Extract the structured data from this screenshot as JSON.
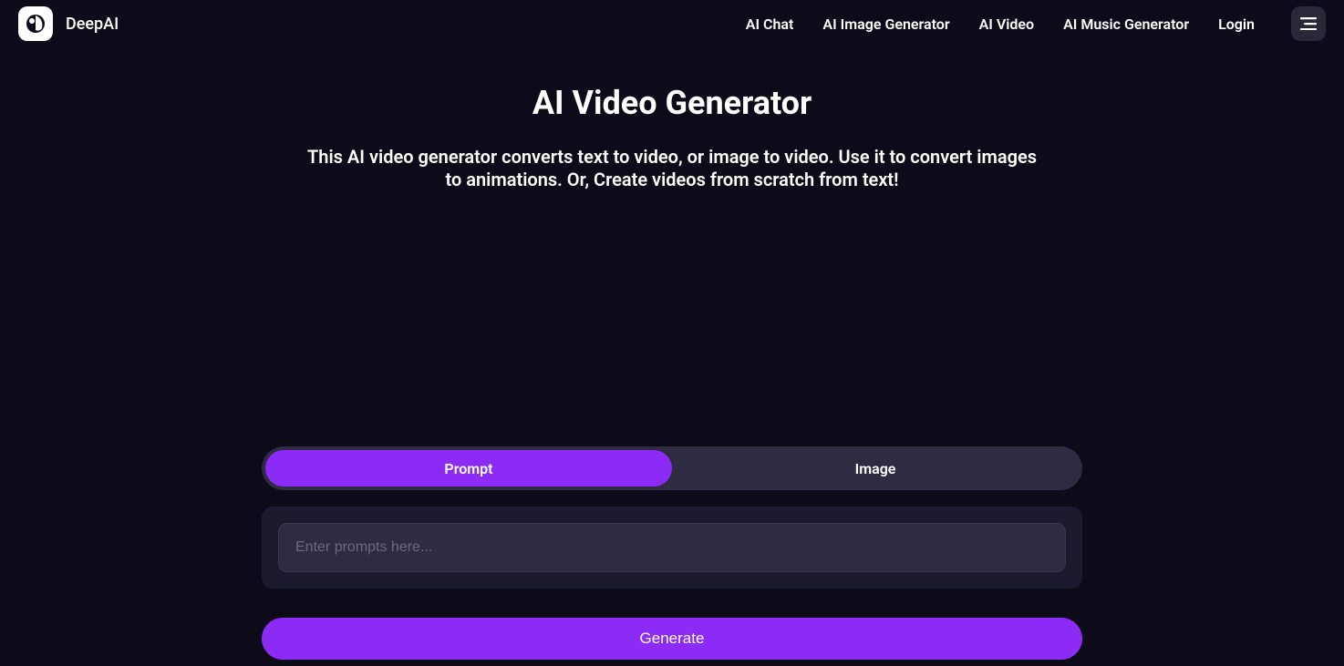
{
  "header": {
    "brand_name": "DeepAI",
    "nav_items": [
      "AI Chat",
      "AI Image Generator",
      "AI Video",
      "AI Music Generator",
      "Login"
    ]
  },
  "main": {
    "title": "AI Video Generator",
    "subtitle": "This AI video generator converts text to video, or image to video. Use it to convert images to animations. Or, Create videos from scratch from text!",
    "tabs": {
      "prompt": "Prompt",
      "image": "Image"
    },
    "prompt_input": {
      "placeholder": "Enter prompts here...",
      "value": ""
    },
    "generate_label": "Generate"
  }
}
